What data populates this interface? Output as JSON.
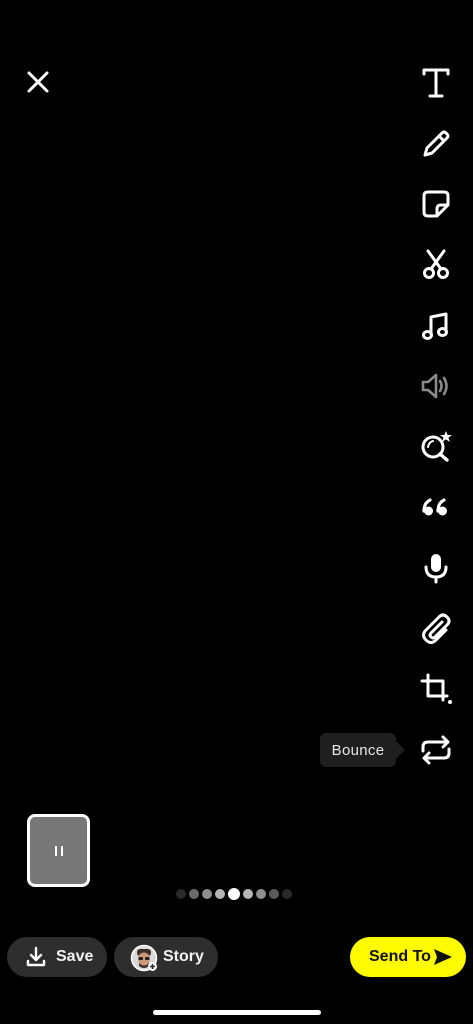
{
  "toolbar": {
    "tools": [
      {
        "name": "text",
        "icon": "text-icon"
      },
      {
        "name": "draw",
        "icon": "pencil-icon"
      },
      {
        "name": "sticker",
        "icon": "sticker-icon"
      },
      {
        "name": "scissors",
        "icon": "scissors-icon"
      },
      {
        "name": "music",
        "icon": "music-note-icon"
      },
      {
        "name": "sound",
        "icon": "speaker-icon"
      },
      {
        "name": "lens",
        "icon": "lens-search-icon"
      },
      {
        "name": "quote",
        "icon": "quote-icon"
      },
      {
        "name": "voice",
        "icon": "microphone-icon"
      },
      {
        "name": "attach",
        "icon": "paperclip-icon"
      },
      {
        "name": "crop",
        "icon": "crop-icon"
      },
      {
        "name": "loop",
        "icon": "loop-icon"
      }
    ],
    "bounce_tooltip": "Bounce"
  },
  "bottom_bar": {
    "save_label": "Save",
    "story_label": "Story",
    "send_label": "Send To"
  },
  "pager": {
    "total": 9,
    "active_index": 4
  },
  "colors": {
    "background": "#000000",
    "send_button": "#fffc00",
    "pill": "#2e2e2e"
  }
}
